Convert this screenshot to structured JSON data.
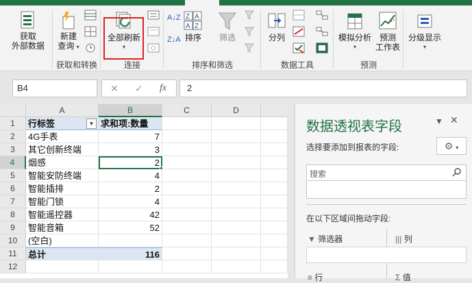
{
  "ribbon": {
    "get_external_label_1": "获取",
    "get_external_label_2": "外部数据",
    "new_query_label_1": "新建",
    "new_query_label_2": "查询",
    "refresh_all_label": "全部刷新",
    "sort_label": "排序",
    "filter_label": "筛选",
    "split_label": "分列",
    "whatif_label": "模拟分析",
    "forecast_label_1": "预测",
    "forecast_label_2": "工作表",
    "outline_label": "分级显示",
    "sort_az": "A↓Z",
    "group_get_transform": "获取和转换",
    "group_connections": "连接",
    "group_sort_filter": "排序和筛选",
    "group_data_tools": "数据工具",
    "group_forecast": "预测",
    "accent_color": "#217346",
    "highlight_color": "#e02020"
  },
  "formula_bar": {
    "name_box": "B4",
    "cancel_icon": "✕",
    "enter_icon": "✓",
    "fx_label": "fx",
    "value": "2"
  },
  "sheet": {
    "columns": [
      "A",
      "B",
      "C",
      "D"
    ],
    "rows": [
      "1",
      "2",
      "3",
      "4",
      "5",
      "6",
      "7",
      "8",
      "9",
      "10",
      "11",
      "12"
    ],
    "header_row_label": "行标签",
    "header_value_label": "求和项:数量",
    "data": [
      {
        "label": "4G手表",
        "value": "7"
      },
      {
        "label": "其它创新终端",
        "value": "3"
      },
      {
        "label": "烟感",
        "value": "2"
      },
      {
        "label": "智能安防终端",
        "value": "4"
      },
      {
        "label": "智能插排",
        "value": "2"
      },
      {
        "label": "智能门锁",
        "value": "4"
      },
      {
        "label": "智能遥控器",
        "value": "42"
      },
      {
        "label": "智能音箱",
        "value": "52"
      },
      {
        "label": "(空白)",
        "value": ""
      }
    ],
    "total_label": "总计",
    "total_value": "116",
    "selected_cell": "B4",
    "pivot_color": "#dce6f2"
  },
  "pivot_pane": {
    "title": "数据透视表字段",
    "dropdown_icon": "▼",
    "close_icon": "✕",
    "subtitle": "选择要添加到报表的字段:",
    "gear_icon": "⚙",
    "search_placeholder": "搜索",
    "areas_label": "在以下区域间拖动字段:",
    "filter_area": "筛选器",
    "columns_area": "列",
    "rows_area": "行",
    "values_area": "值"
  }
}
